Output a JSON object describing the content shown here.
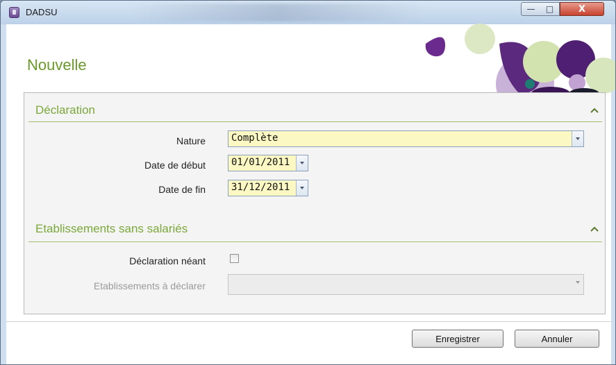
{
  "window": {
    "title": "DADSU"
  },
  "controls": {
    "minimize": "—",
    "maximize": "□",
    "close": "X"
  },
  "page": {
    "heading": "Nouvelle"
  },
  "sections": {
    "declaration": {
      "title": "Déclaration",
      "nature_label": "Nature",
      "nature_value": "Complète",
      "date_debut_label": "Date de début",
      "date_debut_value": "01/01/2011",
      "date_fin_label": "Date de fin",
      "date_fin_value": "31/12/2011"
    },
    "etablissements": {
      "title": "Etablissements sans salariés",
      "neant_label": "Déclaration néant",
      "neant_checked": false,
      "a_declarer_label": "Etablissements à déclarer",
      "a_declarer_value": ""
    }
  },
  "buttons": {
    "save": "Enregistrer",
    "cancel": "Annuler"
  },
  "colors": {
    "accent_green": "#7aa83a",
    "field_yellow": "#fbf8c4",
    "purple": "#5b2a7e"
  }
}
